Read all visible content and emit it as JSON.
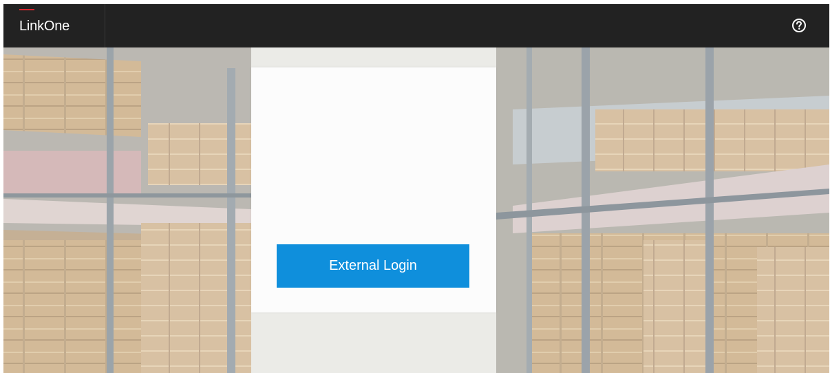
{
  "header": {
    "brand_name": "LinkOne",
    "brand_accent_color": "#d7262e",
    "help_icon": "help-circle-icon"
  },
  "login": {
    "button_label": "External Login",
    "button_color": "#0f8fdc"
  },
  "background": {
    "subject": "warehouse-shelving-photo"
  }
}
